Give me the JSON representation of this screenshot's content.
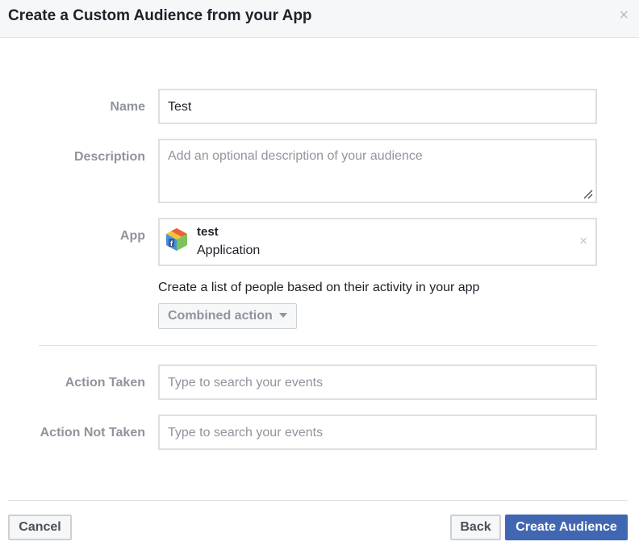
{
  "dialog": {
    "title": "Create a Custom Audience from your App",
    "close_symbol": "×"
  },
  "form": {
    "name": {
      "label": "Name",
      "value": "Test"
    },
    "description": {
      "label": "Description",
      "placeholder": "Add an optional description of your audience"
    },
    "app": {
      "label": "App",
      "name": "test",
      "type": "Application",
      "remove_symbol": "×",
      "icon": "facebook-app-cube-icon"
    },
    "helper_text": "Create a list of people based on their activity in your app",
    "combined_action": {
      "label": "Combined action",
      "icon": "caret-down-icon"
    },
    "action_taken": {
      "label": "Action Taken",
      "placeholder": "Type to search your events"
    },
    "action_not_taken": {
      "label": "Action Not Taken",
      "placeholder": "Type to search your events"
    }
  },
  "footer": {
    "cancel_label": "Cancel",
    "back_label": "Back",
    "create_label": "Create Audience"
  },
  "colors": {
    "primary": "#4267b2",
    "label_gray": "#90949c",
    "border": "#dddfe2"
  }
}
